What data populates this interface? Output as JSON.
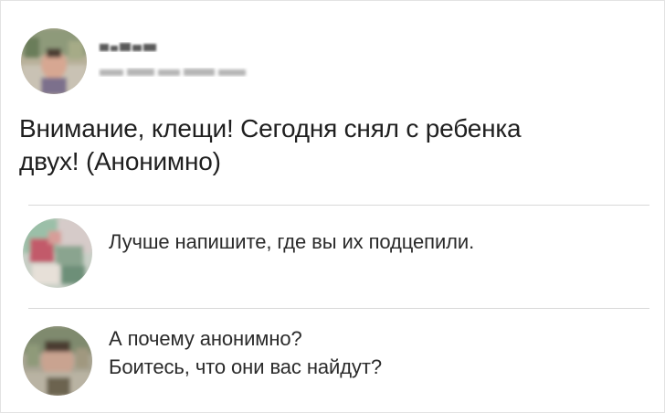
{
  "post": {
    "text_lines": [
      "Внимание, клещи! Сегодня снял с ребенка",
      "двух! (Анонимно)"
    ]
  },
  "comments": [
    {
      "avatar_icon": "blurred-avatar-icon",
      "lines": [
        "Лучше напишите, где вы их подцепили."
      ]
    },
    {
      "avatar_icon": "blurred-avatar-icon",
      "lines": [
        "А почему анонимно?",
        "Боитесь, что они вас найдут?"
      ]
    }
  ],
  "colors": {
    "text": "#1f1f1f",
    "divider": "#d8d8d8",
    "background": "#ffffff"
  }
}
